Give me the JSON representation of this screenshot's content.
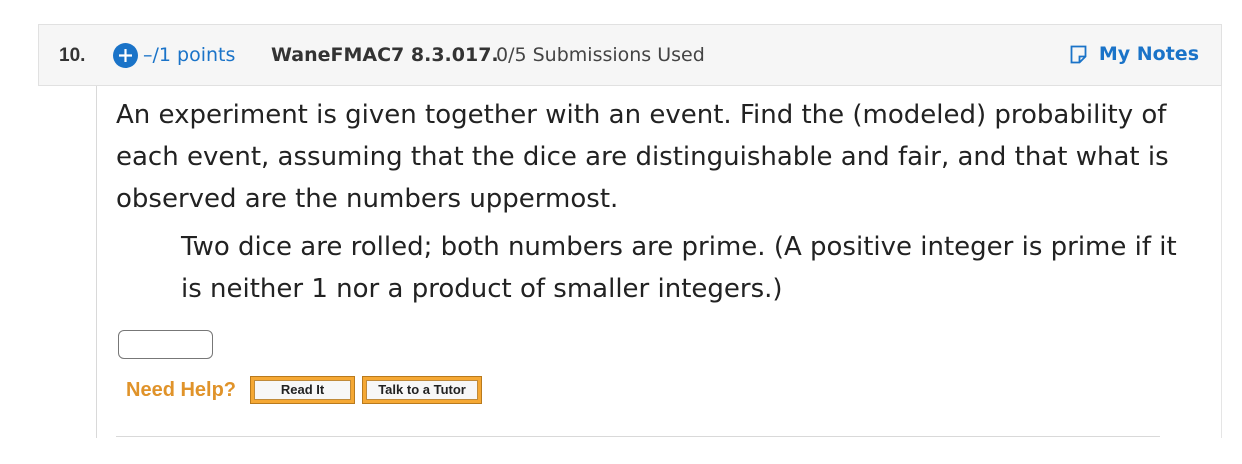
{
  "question": {
    "number": "10.",
    "points": "–/1 points",
    "assignment_id": "WaneFMAC7 8.3.017.",
    "submissions": "0/5 Submissions Used",
    "my_notes_label": "My Notes",
    "prompt": "An experiment is given together with an event. Find the (modeled) probability of each event, assuming that the dice are distinguishable and fair, and that what is observed are the numbers uppermost.",
    "event": "Two dice are rolled; both numbers are prime. (A positive integer is prime if it is neither 1 nor a product of smaller integers.)",
    "answer_value": "",
    "need_help_label": "Need Help?",
    "read_it_label": "Read It",
    "talk_to_tutor_label": "Talk to a Tutor"
  },
  "icons": {
    "plus": "plus-icon",
    "notes": "notes-icon"
  },
  "colors": {
    "link_blue": "#1a73c8",
    "help_orange": "#e0932a",
    "button_orange": "#f5a834"
  }
}
